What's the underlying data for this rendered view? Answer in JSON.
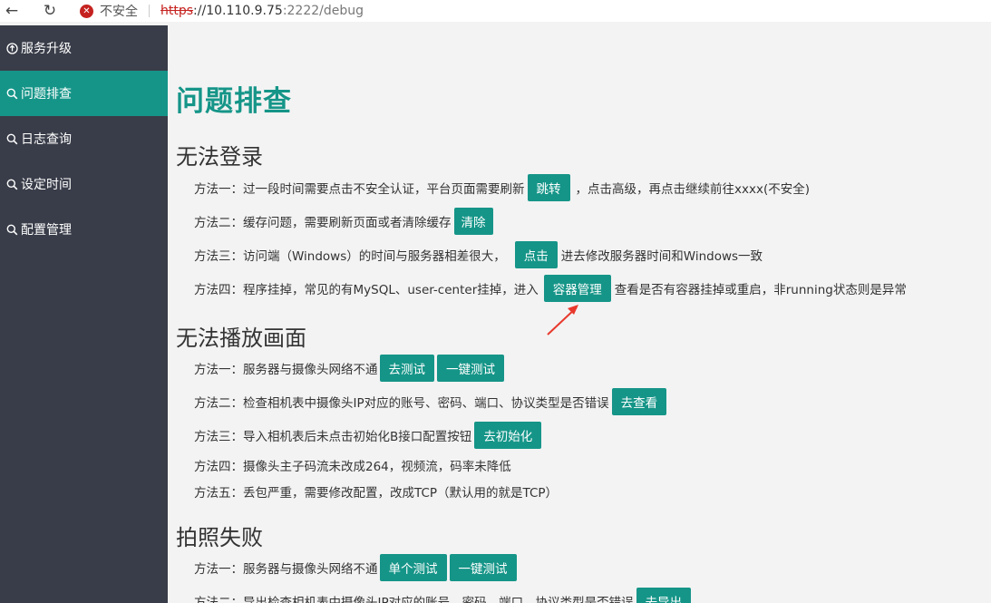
{
  "browser": {
    "back_icon": "←",
    "reload_icon": "↻",
    "insecure_label": "不安全",
    "url_scheme": "https",
    "url_host": "://10.110.9.75",
    "url_port_path": ":2222/debug"
  },
  "sidebar": {
    "items": [
      {
        "icon": "↑",
        "label": "服务升级",
        "active": false
      },
      {
        "icon": "⚲",
        "label": "问题排查",
        "active": true
      },
      {
        "icon": "⚲",
        "label": "日志查询",
        "active": false
      },
      {
        "icon": "⚲",
        "label": "设定时间",
        "active": false
      },
      {
        "icon": "⚲",
        "label": "配置管理",
        "active": false
      }
    ]
  },
  "page": {
    "title": "问题排查",
    "accent_color": "#159588",
    "sections": [
      {
        "title": "无法登录",
        "methods": [
          {
            "text": "方法一：过一段时间需要点击不安全认证，平台页面需要刷新",
            "buttons": [
              "跳转"
            ],
            "after": "，点击高级，再点击继续前往xxxx(不安全)"
          },
          {
            "text": "方法二：缓存问题，需要刷新页面或者清除缓存",
            "buttons": [
              "清除"
            ],
            "after": ""
          },
          {
            "text": "方法三：访问端（Windows）的时间与服务器相差很大，",
            "buttons": [
              "点击"
            ],
            "after": "进去修改服务器时间和Windows一致"
          },
          {
            "text": "方法四：程序挂掉，常见的有MySQL、user-center挂掉，进入",
            "buttons": [
              "容器管理"
            ],
            "after": "查看是否有容器挂掉或重启，非running状态则是异常"
          }
        ]
      },
      {
        "title": "无法播放画面",
        "methods": [
          {
            "text": "方法一：服务器与摄像头网络不通",
            "buttons": [
              "去测试",
              "一键测试"
            ],
            "after": ""
          },
          {
            "text": "方法二：检查相机表中摄像头IP对应的账号、密码、端口、协议类型是否错误",
            "buttons": [
              "去查看"
            ],
            "after": ""
          },
          {
            "text": "方法三：导入相机表后未点击初始化B接口配置按钮",
            "buttons": [
              "去初始化"
            ],
            "after": ""
          },
          {
            "text": "方法四：摄像头主子码流未改成264，视频流，码率未降低",
            "buttons": [],
            "after": ""
          },
          {
            "text": "方法五：丢包严重，需要修改配置，改成TCP（默认用的就是TCP）",
            "buttons": [],
            "after": ""
          }
        ]
      },
      {
        "title": "拍照失败",
        "methods": [
          {
            "text": "方法一：服务器与摄像头网络不通",
            "buttons": [
              "单个测试",
              "一键测试"
            ],
            "after": ""
          },
          {
            "text": "方法二：导出检查相机表中摄像头IP对应的账号、密码、端口、协议类型是否错误",
            "buttons": [
              "去导出"
            ],
            "after": ""
          }
        ]
      }
    ]
  }
}
